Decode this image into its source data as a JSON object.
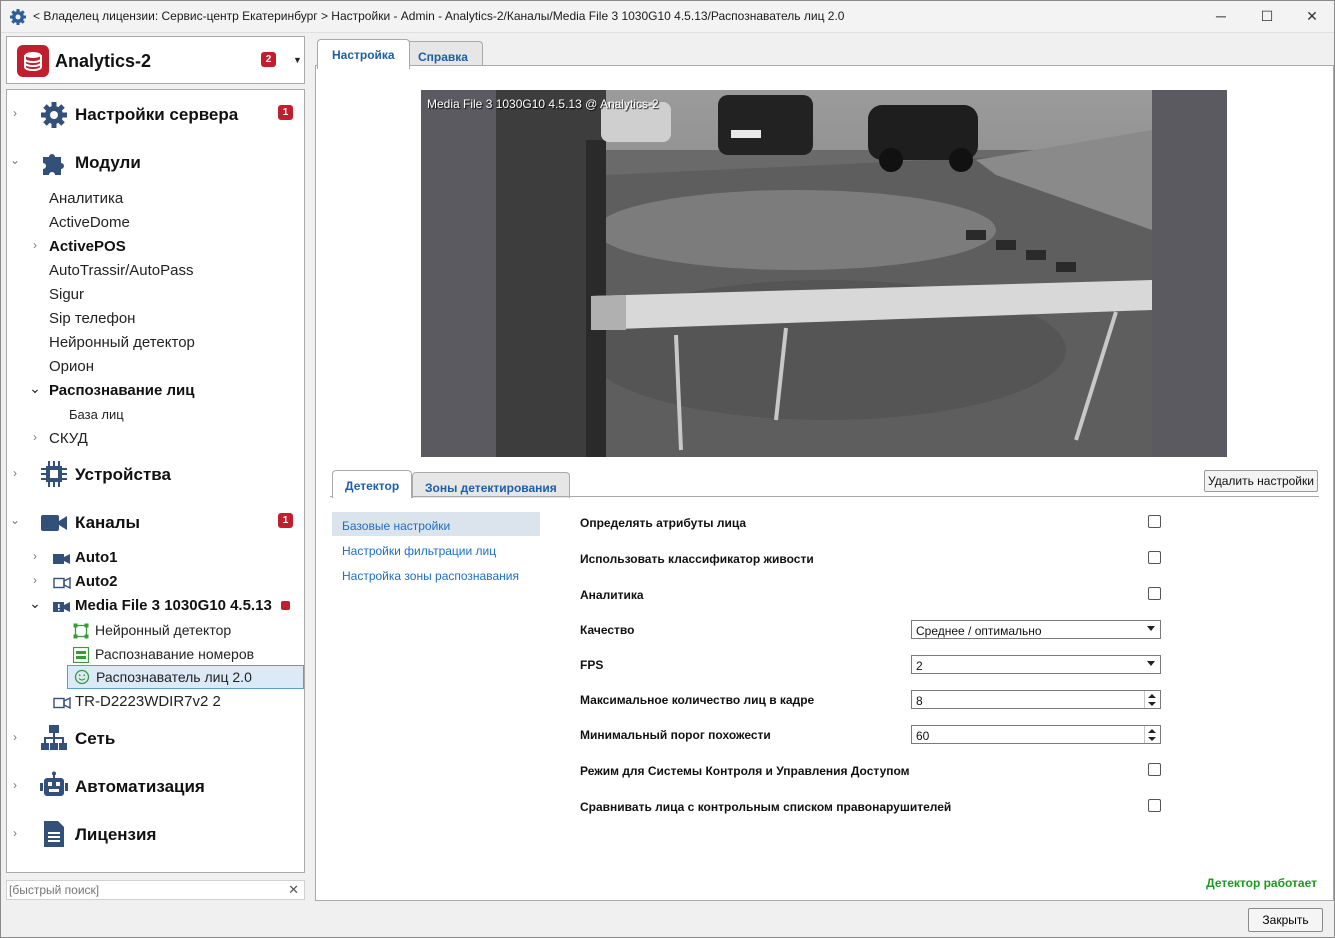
{
  "window": {
    "title": "< Владелец лицензии: Сервис-центр Екатеринбург > Настройки - Admin - Analytics-2/Каналы/Media File 3 1030G10 4.5.13/Распознаватель лиц 2.0",
    "minimize": "─",
    "maximize": "☐",
    "close": "✕"
  },
  "sidebar": {
    "app_name": "Analytics-2",
    "app_badge": "2",
    "tree": {
      "server_settings": {
        "label": "Настройки сервера",
        "badge": "1"
      },
      "modules": {
        "label": "Модули",
        "items": [
          "Аналитика",
          "ActiveDome",
          "ActivePOS",
          "AutoTrassir/AutoPass",
          "Sigur",
          "Sip телефон",
          "Нейронный детектор",
          "Орион",
          "Распознавание лиц",
          "База лиц",
          "СКУД"
        ]
      },
      "devices": {
        "label": "Устройства"
      },
      "channels": {
        "label": "Каналы",
        "badge": "1",
        "auto1": "Auto1",
        "auto2": "Auto2",
        "media": "Media File 3 1030G10 4.5.13",
        "sub": [
          "Нейронный детектор",
          "Распознавание номеров",
          "Распознаватель лиц 2.0"
        ],
        "tr": "TR-D2223WDIR7v2 2"
      },
      "network": {
        "label": "Сеть"
      },
      "automation": {
        "label": "Автоматизация"
      },
      "license": {
        "label": "Лицензия"
      }
    },
    "search_placeholder": "[быстрый поиск]",
    "search_clear": "✕"
  },
  "main": {
    "tabs": [
      "Настройка",
      "Справка"
    ],
    "video_osd": "Media File 3 1030G10 4.5.13 @ Analytics-2",
    "delete_button": "Удалить настройки",
    "subtabs": [
      "Детектор",
      "Зоны детектирования"
    ],
    "nav": [
      "Базовые настройки",
      "Настройки фильтрации лиц",
      "Настройка зоны распознавания"
    ],
    "fields": {
      "attrs": {
        "label": "Определять атрибуты лица",
        "checked": false
      },
      "liveness": {
        "label": "Использовать классификатор живости",
        "checked": false
      },
      "analytics": {
        "label": "Аналитика",
        "checked": false
      },
      "quality": {
        "label": "Качество",
        "value": "Среднее / оптимально"
      },
      "fps": {
        "label": "FPS",
        "value": "2"
      },
      "max_faces": {
        "label": "Максимальное количество лиц в кадре",
        "value": "8"
      },
      "min_threshold": {
        "label": "Минимальный порог похожести",
        "value": "60"
      },
      "acs_mode": {
        "label": "Режим для Системы Контроля и Управления Доступом",
        "checked": false
      },
      "watchlist": {
        "label": "Сравнивать лица с контрольным списком правонарушителей",
        "checked": false
      }
    },
    "status": "Детектор работает",
    "close_button": "Закрыть"
  }
}
